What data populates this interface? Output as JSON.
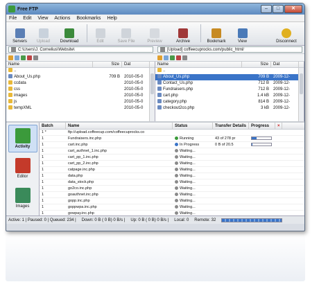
{
  "window": {
    "title": "Free FTP",
    "controls": [
      "–",
      "□",
      "✕"
    ]
  },
  "menu": [
    "File",
    "Edit",
    "View",
    "Actions",
    "Bookmarks",
    "Help"
  ],
  "toolbar": {
    "servers": "Servers",
    "upload": "Upload",
    "download": "Download",
    "edit": "Edit",
    "save_file": "Save File",
    "preview": "Preview",
    "archive": "Archive",
    "bookmark": "Bookmark",
    "view": "View",
    "disconnect": "Disconnect"
  },
  "local": {
    "path": "C:\\Users\\J. Cornelius\\Website\\",
    "cols": [
      "Name",
      "Size",
      "Dat"
    ],
    "files": [
      {
        "name": "..",
        "size": "",
        "date": ""
      },
      {
        "name": "About_Us.php",
        "size": "709 B",
        "date": "2010-05-0"
      },
      {
        "name": "ccdata",
        "size": "",
        "date": "2010-05-0"
      },
      {
        "name": "css",
        "size": "",
        "date": "2010-05-0"
      },
      {
        "name": "images",
        "size": "",
        "date": "2010-05-0"
      },
      {
        "name": "js",
        "size": "",
        "date": "2010-05-0"
      },
      {
        "name": "tempXML",
        "size": "",
        "date": "2010-05-0"
      }
    ]
  },
  "remote": {
    "path": "[Upload] coffeecuprocks.com/public_html/",
    "cols": [
      "Name",
      "Size",
      "Dat"
    ],
    "files": [
      {
        "name": "..",
        "size": "",
        "date": ""
      },
      {
        "name": "About_Us.php",
        "size": "709 B",
        "date": "2009-12-"
      },
      {
        "name": "Contact_Us.php",
        "size": "712 B",
        "date": "2009-12-"
      },
      {
        "name": "Fundraisers.php",
        "size": "712 B",
        "date": "2009-12-"
      },
      {
        "name": "cart.php",
        "size": "1.4 kB",
        "date": "2009-12-"
      },
      {
        "name": "category.php",
        "size": "814 B",
        "date": "2009-12-"
      },
      {
        "name": "checkout2co.php",
        "size": "3 kB",
        "date": "2009-12-"
      }
    ]
  },
  "side": {
    "activity": "Activity",
    "editor": "Editor",
    "images": "Images"
  },
  "queue": {
    "cols": [
      "Batch",
      "Name",
      "Status",
      "Transfer Details",
      "Progress",
      "×"
    ],
    "rows": [
      {
        "batch": "1 *",
        "name": "ftp://upload.coffeecup.com/coffeecuprocks.co",
        "status": "",
        "details": "",
        "progress": 0
      },
      {
        "batch": "1",
        "name": "Fundraisers.inc.php",
        "status": "Running",
        "details": "43 of 278 pr",
        "progress": 0.25
      },
      {
        "batch": "1",
        "name": "cart.inc.php",
        "status": "In Progress",
        "details": "0 B of 20.5",
        "progress": 0.05
      },
      {
        "batch": "1",
        "name": "cart_authnet_1.inc.php",
        "status": "Waiting...",
        "details": "",
        "progress": 0
      },
      {
        "batch": "1",
        "name": "cart_pp_1.inc.php",
        "status": "Waiting...",
        "details": "",
        "progress": 0
      },
      {
        "batch": "1",
        "name": "cart_pp_2.inc.php",
        "status": "Waiting...",
        "details": "",
        "progress": 0
      },
      {
        "batch": "1",
        "name": "catpage.inc.php",
        "status": "Waiting...",
        "details": "",
        "progress": 0
      },
      {
        "batch": "1",
        "name": "data.php",
        "status": "Waiting...",
        "details": "",
        "progress": 0
      },
      {
        "batch": "1",
        "name": "data_stock.php",
        "status": "Waiting...",
        "details": "",
        "progress": 0
      },
      {
        "batch": "1",
        "name": "go2co.inc.php",
        "status": "Waiting...",
        "details": "",
        "progress": 0
      },
      {
        "batch": "1",
        "name": "goauthnet.inc.php",
        "status": "Waiting...",
        "details": "",
        "progress": 0
      },
      {
        "batch": "1",
        "name": "gopp.inc.php",
        "status": "Waiting...",
        "details": "",
        "progress": 0
      },
      {
        "batch": "1",
        "name": "goppwpa.inc.php",
        "status": "Waiting...",
        "details": "",
        "progress": 0
      },
      {
        "batch": "1",
        "name": "gowpay.inc.php",
        "status": "Waiting...",
        "details": "",
        "progress": 0
      }
    ]
  },
  "status": {
    "active": "Active: 1 | Paused: 0 | Queued: 234 |",
    "down": "Down: 0 B ( 0 B) 0 B/s |",
    "up": "Up: 0 B ( 0 B) 0 B/s |",
    "local": "Local: 0",
    "remote": "Remote: 32"
  },
  "colors": {
    "selection": "#3a74c8",
    "title_bar": "#5d8ac0"
  }
}
